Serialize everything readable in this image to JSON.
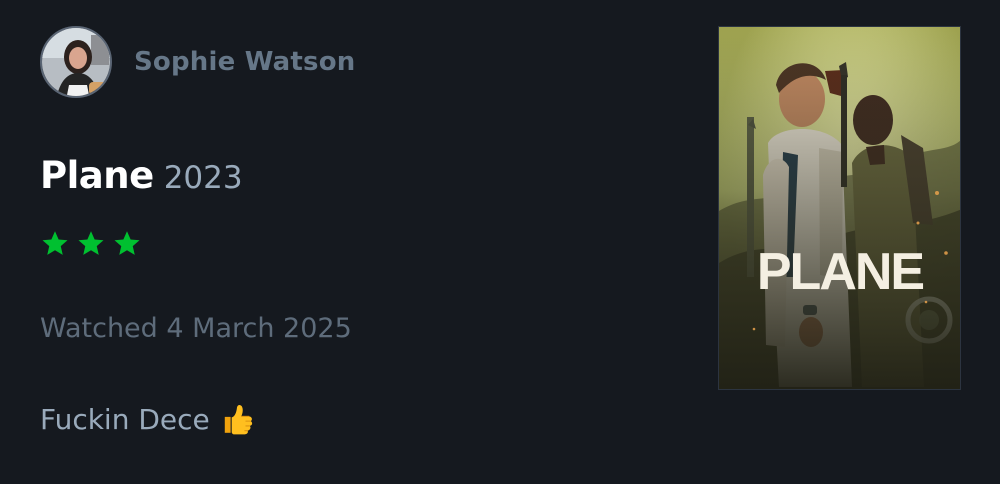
{
  "author": {
    "name": "Sophie Watson",
    "avatar_icon": "avatar-photo"
  },
  "film": {
    "title": "Plane",
    "year": "2023",
    "poster_title": "PLANE"
  },
  "rating": {
    "stars": 3,
    "max_stars": 5,
    "star_color": "#00c030"
  },
  "watched_date": "Watched 4 March 2025",
  "review": {
    "text": "Fuckin Dece",
    "emoji_icon": "thumbs-up-icon"
  },
  "colors": {
    "background": "#15191f",
    "title": "#ffffff",
    "muted": "#99aabb",
    "author": "#667788"
  }
}
